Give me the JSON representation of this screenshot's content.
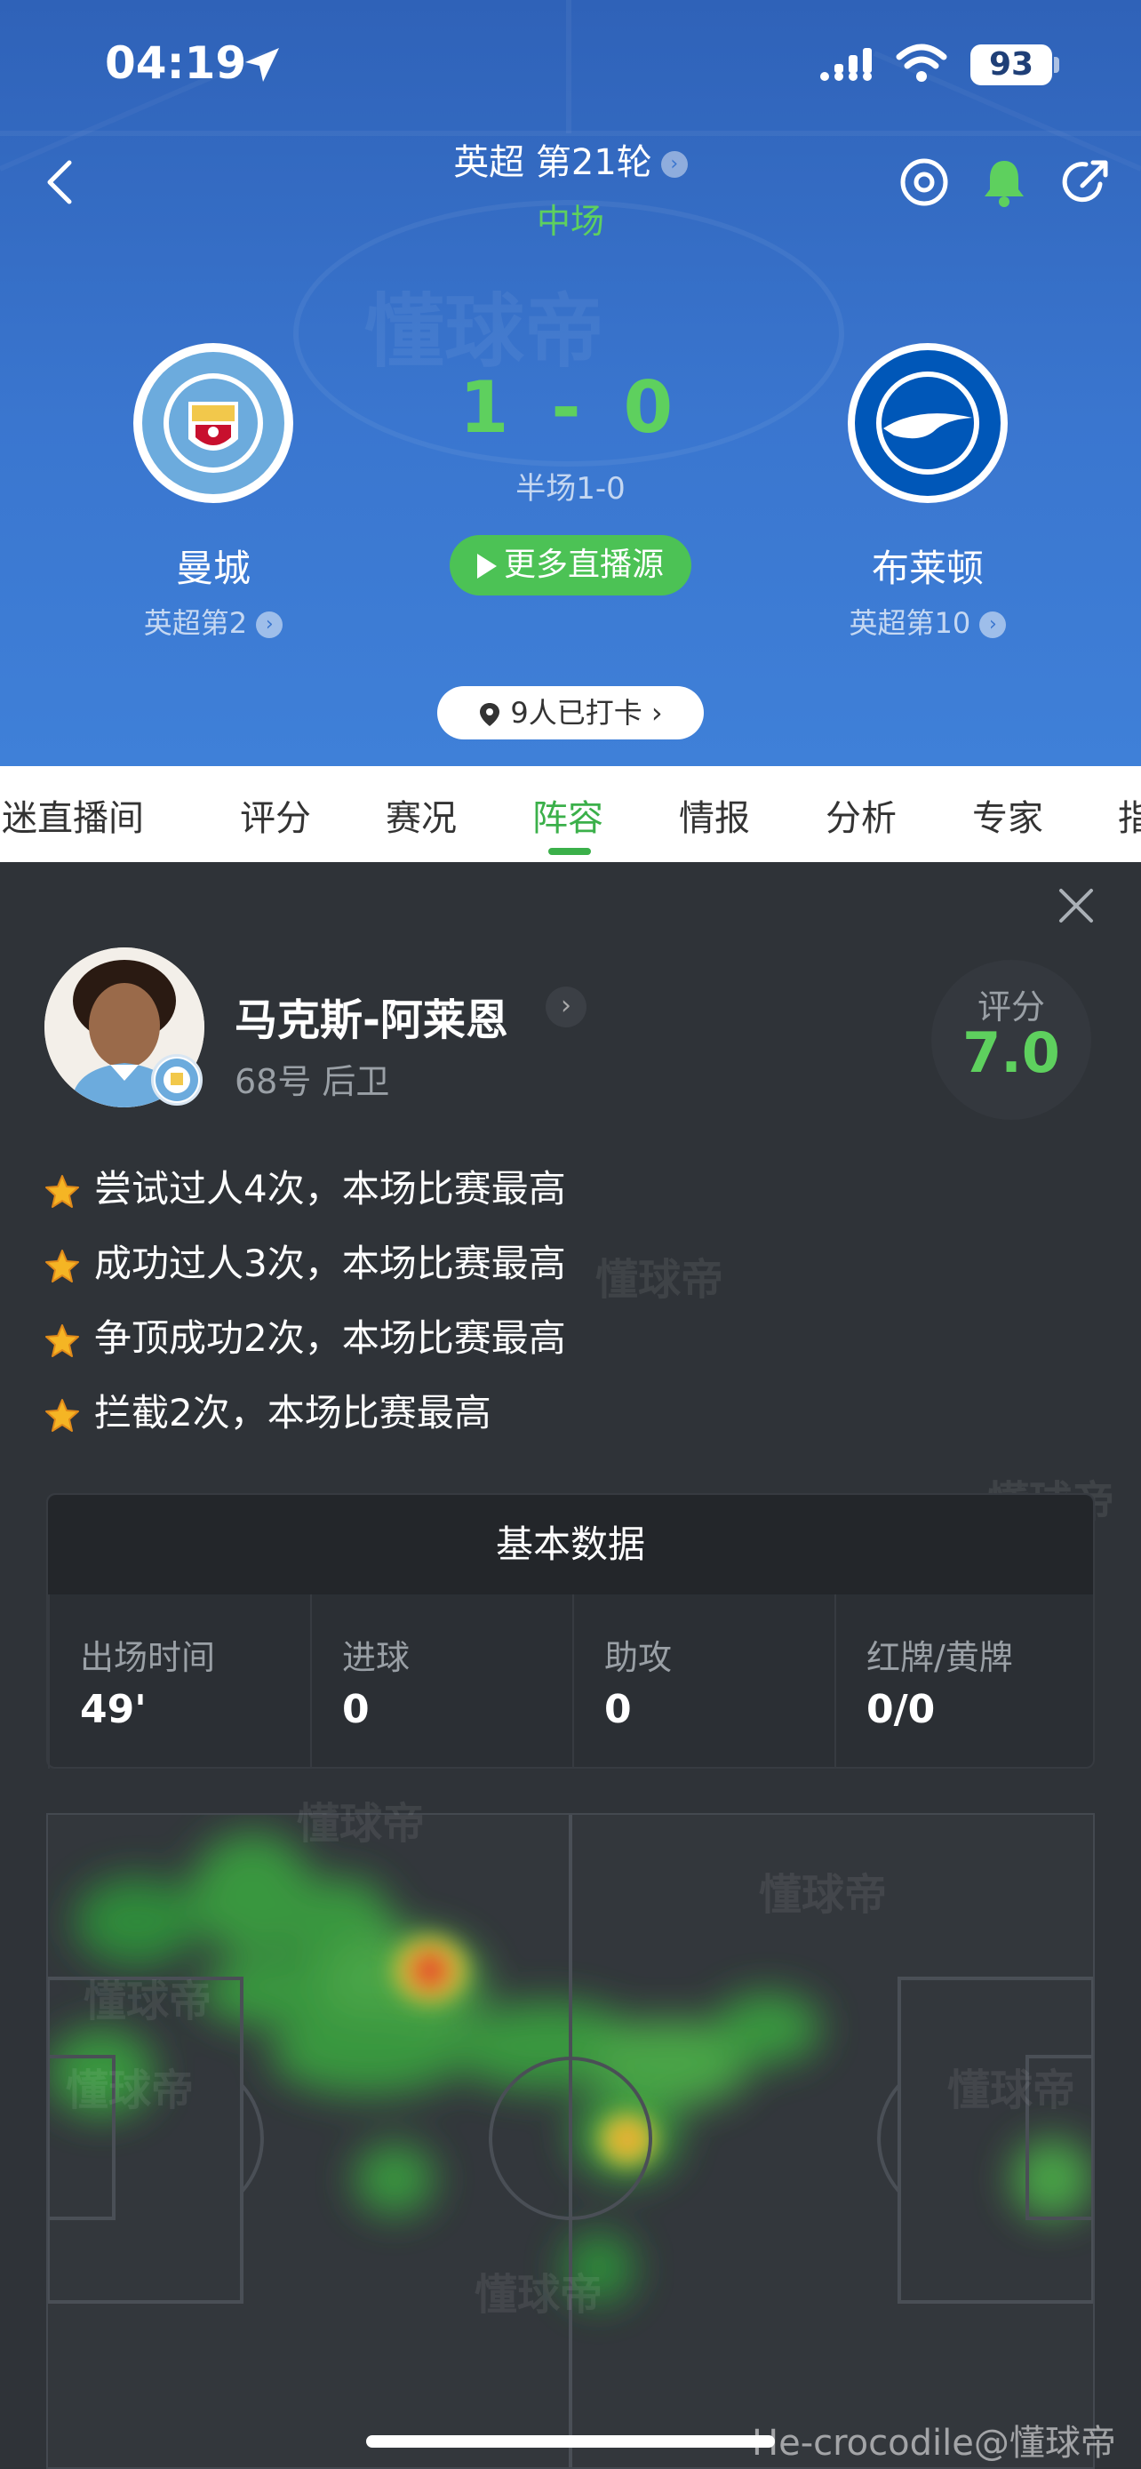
{
  "status_bar": {
    "time": "04:19",
    "battery": "93"
  },
  "header": {
    "round": "英超 第21轮",
    "match_status": "中场",
    "score": "1 - 0",
    "halftime": "半场1-0",
    "live_button": "更多直播源",
    "checkin": "9人已打卡",
    "home": {
      "name": "曼城",
      "rank": "英超第2"
    },
    "away": {
      "name": "布莱顿",
      "rank": "英超第10"
    }
  },
  "tabs": [
    "迷直播间",
    "评分",
    "赛况",
    "阵容",
    "情报",
    "分析",
    "专家",
    "指"
  ],
  "active_tab": "阵容",
  "player": {
    "name": "马克斯-阿莱恩",
    "sub": "68号 后卫",
    "rating_label": "评分",
    "rating": "7.0"
  },
  "highlights": [
    "尝试过人4次，本场比赛最高",
    "成功过人3次，本场比赛最高",
    "争顶成功2次，本场比赛最高",
    "拦截2次，本场比赛最高"
  ],
  "stats": {
    "title": "基本数据",
    "items": [
      {
        "label": "出场时间",
        "value": "49'"
      },
      {
        "label": "进球",
        "value": "0"
      },
      {
        "label": "助攻",
        "value": "0"
      },
      {
        "label": "红牌/黄牌",
        "value": "0/0"
      }
    ]
  },
  "watermark": "懂球帝",
  "credit": "He-crocodile@懂球帝",
  "colors": {
    "accent": "#3bb04a",
    "score": "#5ed05e",
    "header_bg": "#3a76cf"
  }
}
